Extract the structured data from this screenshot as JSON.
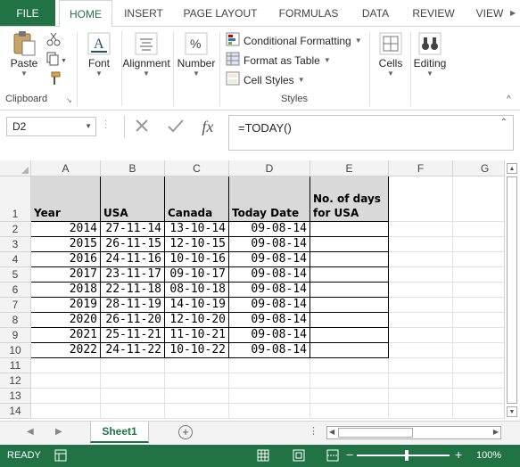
{
  "ribbon_tabs": [
    "FILE",
    "HOME",
    "INSERT",
    "PAGE LAYOUT",
    "FORMULAS",
    "DATA",
    "REVIEW",
    "VIEW"
  ],
  "active_tab": "HOME",
  "clipboard": {
    "paste_label": "Paste",
    "group_label": "Clipboard"
  },
  "font_group": {
    "font_label": "Font",
    "alignment_label": "Alignment",
    "number_label": "Number"
  },
  "styles": {
    "conditional_formatting": "Conditional Formatting",
    "format_as_table": "Format as Table",
    "cell_styles": "Cell Styles",
    "group_label": "Styles"
  },
  "cells_label": "Cells",
  "editing_label": "Editing",
  "namebox": "D2",
  "fx_label": "fx",
  "formula": "=TODAY()",
  "columns": [
    "A",
    "B",
    "C",
    "D",
    "E",
    "F",
    "G"
  ],
  "rows": [
    "1",
    "2",
    "3",
    "4",
    "5",
    "6",
    "7",
    "8",
    "9",
    "10",
    "11",
    "12",
    "13",
    "14"
  ],
  "table": {
    "headers": [
      "Year",
      "USA",
      "Canada",
      "Today Date",
      "No. of days for USA"
    ],
    "data": [
      [
        "2014",
        "27-11-14",
        "13-10-14",
        "09-08-14",
        ""
      ],
      [
        "2015",
        "26-11-15",
        "12-10-15",
        "09-08-14",
        ""
      ],
      [
        "2016",
        "24-11-16",
        "10-10-16",
        "09-08-14",
        ""
      ],
      [
        "2017",
        "23-11-17",
        "09-10-17",
        "09-08-14",
        ""
      ],
      [
        "2018",
        "22-11-18",
        "08-10-18",
        "09-08-14",
        ""
      ],
      [
        "2019",
        "28-11-19",
        "14-10-19",
        "09-08-14",
        ""
      ],
      [
        "2020",
        "26-11-20",
        "12-10-20",
        "09-08-14",
        ""
      ],
      [
        "2021",
        "25-11-21",
        "11-10-21",
        "09-08-14",
        ""
      ],
      [
        "2022",
        "24-11-22",
        "10-10-22",
        "09-08-14",
        ""
      ]
    ]
  },
  "sheet_tab": "Sheet1",
  "status": {
    "ready": "READY",
    "zoom": "100%"
  },
  "colors": {
    "accent": "#217346",
    "header_fill": "#d9d9d9"
  }
}
